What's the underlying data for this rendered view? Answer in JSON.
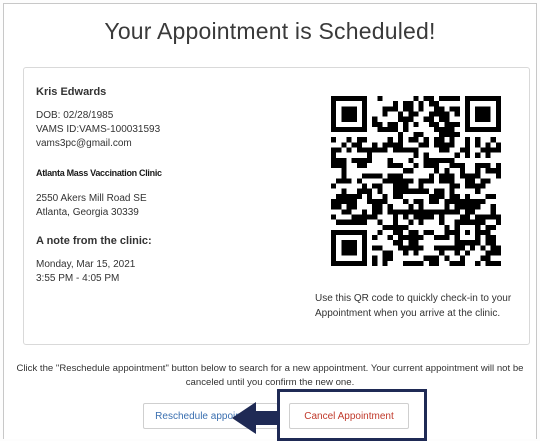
{
  "page": {
    "title": "Your Appointment is Scheduled!"
  },
  "patient": {
    "name": "Kris Edwards",
    "dob": "DOB: 02/28/1985",
    "vams_id": "VAMS ID:VAMS-100031593",
    "email": "vams3pc@gmail.com"
  },
  "clinic": {
    "name": "Atlanta Mass Vaccination Clinic",
    "address_line1": "2550 Akers Mill Road SE",
    "address_line2": "Atlanta, Georgia 30339",
    "note_heading": "A note from the clinic:"
  },
  "appointment": {
    "date": "Monday, Mar 15, 2021",
    "time": "3:55 PM - 4:05 PM"
  },
  "qr": {
    "caption": "Use this QR code to quickly check-in to your Appointment when you arrive at the clinic."
  },
  "info": {
    "text": "Click the \"Reschedule appointment\" button below to search for a new appointment. Your current appointment will not be canceled until you confirm the new one."
  },
  "buttons": {
    "reschedule": "Reschedule appointment",
    "cancel": "Cancel Appointment"
  },
  "colors": {
    "reschedule_text": "#3a6fb0",
    "cancel_text": "#c0392b",
    "highlight_border": "#1f2a55"
  },
  "icons": {
    "arrow": "left-arrow-icon",
    "qr": "qr-code"
  }
}
